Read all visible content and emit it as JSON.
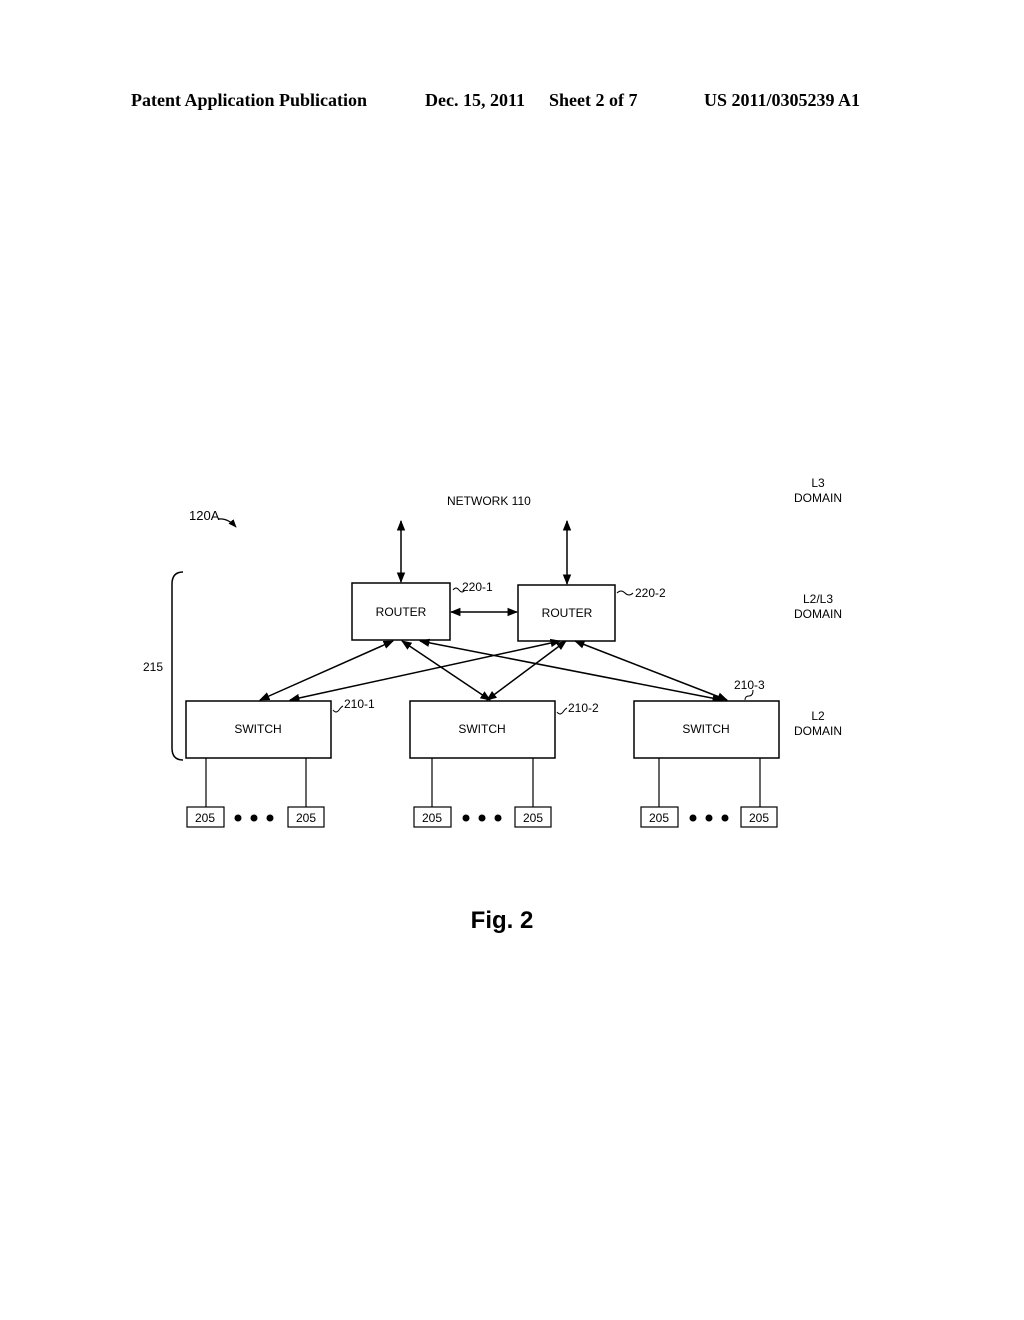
{
  "header": {
    "publication": "Patent Application Publication",
    "date": "Dec. 15, 2011",
    "sheet": "Sheet 2 of 7",
    "number": "US 2011/0305239 A1"
  },
  "figure": {
    "caption": "Fig. 2",
    "system_ref": "120A",
    "network_label": "NETWORK 110",
    "group_ref": "215",
    "domains": {
      "l3": [
        "L3",
        "DOMAIN"
      ],
      "l2l3": [
        "L2/L3",
        "DOMAIN"
      ],
      "l2": [
        "L2",
        "DOMAIN"
      ]
    },
    "routers": [
      {
        "label": "ROUTER",
        "ref": "220-1"
      },
      {
        "label": "ROUTER",
        "ref": "220-2"
      }
    ],
    "switches": [
      {
        "label": "SWITCH",
        "ref": "210-1"
      },
      {
        "label": "SWITCH",
        "ref": "210-2"
      },
      {
        "label": "SWITCH",
        "ref": "210-3"
      }
    ],
    "end_devices": [
      {
        "left": "205",
        "right": "205"
      },
      {
        "left": "205",
        "right": "205"
      },
      {
        "left": "205",
        "right": "205"
      }
    ]
  }
}
